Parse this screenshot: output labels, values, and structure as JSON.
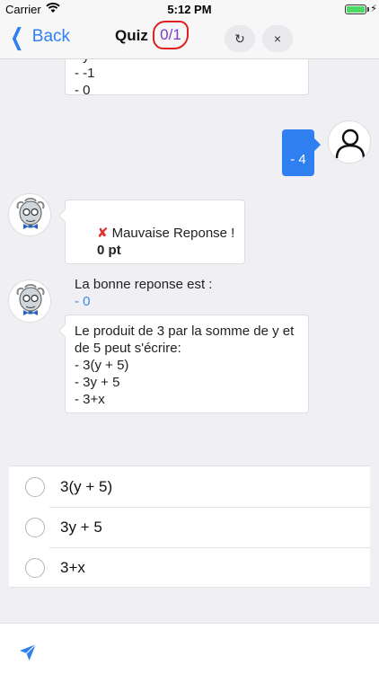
{
  "status_bar": {
    "carrier": "Carrier",
    "time": "5:12 PM",
    "battery_level": 1.0
  },
  "nav": {
    "back_label": "Back",
    "title": "Quiz",
    "score": "0/1",
    "refresh_icon": "↻",
    "close_icon": "×"
  },
  "chat": {
    "prev_question_lines": [
      "- y",
      "- -1",
      "- 0"
    ],
    "user_answer": "- 4",
    "feedback": {
      "mark": "✘",
      "wrong_text": "Mauvaise Reponse !",
      "points": "0 pt",
      "correct_intro": "La bonne reponse est :",
      "correct_answer": "- 0"
    },
    "question_lines": [
      "Le produit de 3 par la somme de y et",
      "de 5 peut s'écrire:",
      "- 3(y + 5)",
      "- 3y + 5",
      "- 3+x"
    ]
  },
  "options": [
    "3(y + 5)",
    "3y + 5",
    "3+x"
  ],
  "colors": {
    "accent": "#2f7ff0",
    "score_circle": "#e02020",
    "score_text": "#7a3cc8"
  }
}
